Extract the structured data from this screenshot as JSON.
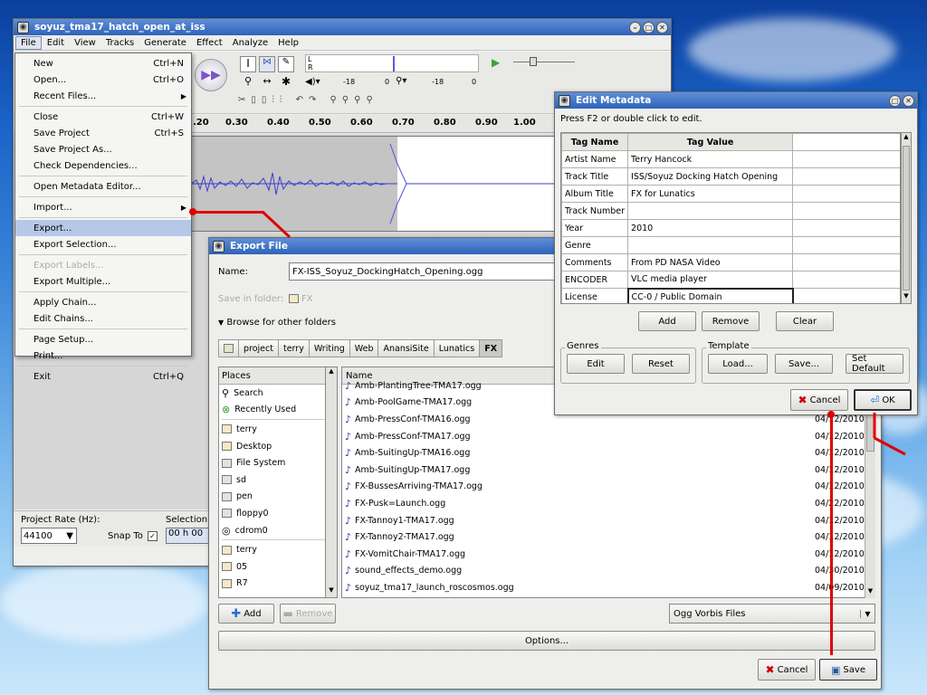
{
  "audacity": {
    "title": "soyuz_tma17_hatch_open_at_iss",
    "menubar": [
      "File",
      "Edit",
      "View",
      "Tracks",
      "Generate",
      "Effect",
      "Analyze",
      "Help"
    ],
    "meter_labels": {
      "l": "L",
      "r": "R",
      "db1": "-18",
      "db2": "0",
      "db3": "-18",
      "db4": "0"
    },
    "ruler": [
      ".20",
      "0.30",
      "0.40",
      "0.50",
      "0.60",
      "0.70",
      "0.80",
      "0.90",
      "1.00"
    ],
    "project_rate_label": "Project Rate (Hz):",
    "project_rate_value": "44100",
    "snap_to_label": "Snap To",
    "selection_label": "Selection",
    "selection_value": "00 h 00"
  },
  "file_menu": [
    {
      "label": "New",
      "accel": "Ctrl+N"
    },
    {
      "label": "Open...",
      "accel": "Ctrl+O"
    },
    {
      "label": "Recent Files...",
      "accel": "",
      "submenu": true
    },
    {
      "sep": true
    },
    {
      "label": "Close",
      "accel": "Ctrl+W"
    },
    {
      "label": "Save Project",
      "accel": "Ctrl+S"
    },
    {
      "label": "Save Project As...",
      "accel": ""
    },
    {
      "label": "Check Dependencies...",
      "accel": ""
    },
    {
      "sep": true
    },
    {
      "label": "Open Metadata Editor...",
      "accel": ""
    },
    {
      "sep": true
    },
    {
      "label": "Import...",
      "accel": "",
      "submenu": true
    },
    {
      "sep": true
    },
    {
      "label": "Export...",
      "accel": "",
      "highlight": true
    },
    {
      "label": "Export Selection...",
      "accel": ""
    },
    {
      "sep": true
    },
    {
      "label": "Export Labels...",
      "accel": "",
      "disabled": true
    },
    {
      "label": "Export Multiple...",
      "accel": ""
    },
    {
      "sep": true
    },
    {
      "label": "Apply Chain...",
      "accel": ""
    },
    {
      "label": "Edit Chains...",
      "accel": ""
    },
    {
      "sep": true
    },
    {
      "label": "Page Setup...",
      "accel": ""
    },
    {
      "label": "Print...",
      "accel": ""
    },
    {
      "sep": true
    },
    {
      "label": "Exit",
      "accel": "Ctrl+Q"
    }
  ],
  "export": {
    "title": "Export File",
    "name_label": "Name:",
    "name_value": "FX-ISS_Soyuz_DockingHatch_Opening.ogg",
    "save_in_label": "Save in folder:",
    "save_in_value": "FX",
    "browse_label": "Browse for other folders",
    "path": [
      "project",
      "terry",
      "Writing",
      "Web",
      "AnansiSite",
      "Lunatics",
      "FX"
    ],
    "places_header": "Places",
    "places": [
      {
        "label": "Search",
        "icon": "search-icon"
      },
      {
        "label": "Recently Used",
        "icon": "recent-icon"
      },
      {
        "sep": true
      },
      {
        "label": "terry",
        "icon": "folder-icon"
      },
      {
        "label": "Desktop",
        "icon": "folder-icon"
      },
      {
        "label": "File System",
        "icon": "drive-icon"
      },
      {
        "label": "sd",
        "icon": "drive-icon"
      },
      {
        "label": "pen",
        "icon": "drive-icon"
      },
      {
        "label": "floppy0",
        "icon": "drive-icon"
      },
      {
        "label": "cdrom0",
        "icon": "disc-icon"
      },
      {
        "sep": true
      },
      {
        "label": "terry",
        "icon": "folder-icon"
      },
      {
        "label": "05",
        "icon": "folder-icon"
      },
      {
        "label": "R7",
        "icon": "folder-icon"
      }
    ],
    "name_col": "Name",
    "files": [
      {
        "name": "Amb-PlantingTree-TMA17.ogg",
        "date": ""
      },
      {
        "name": "Amb-PoolGame-TMA17.ogg",
        "date": "04/12/2010"
      },
      {
        "name": "Amb-PressConf-TMA16.ogg",
        "date": "04/12/2010"
      },
      {
        "name": "Amb-PressConf-TMA17.ogg",
        "date": "04/12/2010"
      },
      {
        "name": "Amb-SuitingUp-TMA16.ogg",
        "date": "04/12/2010"
      },
      {
        "name": "Amb-SuitingUp-TMA17.ogg",
        "date": "04/12/2010"
      },
      {
        "name": "FX-BussesArriving-TMA17.ogg",
        "date": "04/12/2010"
      },
      {
        "name": "FX-Pusk=Launch.ogg",
        "date": "04/22/2010"
      },
      {
        "name": "FX-Tannoy1-TMA17.ogg",
        "date": "04/12/2010"
      },
      {
        "name": "FX-Tannoy2-TMA17.ogg",
        "date": "04/12/2010"
      },
      {
        "name": "FX-VomitChair-TMA17.ogg",
        "date": "04/12/2010"
      },
      {
        "name": "sound_effects_demo.ogg",
        "date": "04/30/2010"
      },
      {
        "name": "soyuz_tma17_launch_roscosmos.ogg",
        "date": "04/09/2010"
      }
    ],
    "add_label": "Add",
    "remove_label": "Remove",
    "filter_value": "Ogg Vorbis Files",
    "options_label": "Options...",
    "cancel_label": "Cancel",
    "save_label": "Save"
  },
  "metadata": {
    "title": "Edit Metadata",
    "hint": "Press F2 or double click to edit.",
    "col_name": "Tag Name",
    "col_value": "Tag Value",
    "rows": [
      {
        "name": "Artist Name",
        "value": "Terry Hancock"
      },
      {
        "name": "Track Title",
        "value": "ISS/Soyuz Docking Hatch Opening"
      },
      {
        "name": "Album Title",
        "value": "FX for Lunatics"
      },
      {
        "name": "Track Number",
        "value": ""
      },
      {
        "name": "Year",
        "value": "2010"
      },
      {
        "name": "Genre",
        "value": ""
      },
      {
        "name": "Comments",
        "value": "From PD NASA Video"
      },
      {
        "name": "ENCODER",
        "value": "VLC media player"
      },
      {
        "name": "License",
        "value": "CC-0 / Public Domain"
      }
    ],
    "add_label": "Add",
    "remove_label": "Remove",
    "clear_label": "Clear",
    "genres_label": "Genres",
    "edit_label": "Edit",
    "reset_label": "Reset",
    "template_label": "Template",
    "load_label": "Load...",
    "save_label": "Save...",
    "setdefault_label": "Set Default",
    "cancel_label": "Cancel",
    "ok_label": "OK"
  },
  "colors": {
    "accent": "#2e63b8",
    "annotation": "#e00000",
    "waveform": "#3c3cd0"
  }
}
